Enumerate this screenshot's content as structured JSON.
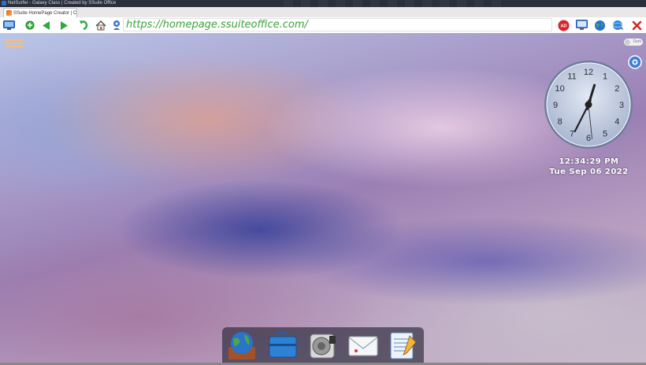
{
  "window": {
    "title": "NetSurfer - Galaxy Class | Created by SSuite Office"
  },
  "tabs": [
    {
      "label": "SSuite HomePage Creator | C"
    }
  ],
  "toolbar": {
    "buttons": [
      {
        "icon": "monitor-icon"
      },
      {
        "icon": "new-tab-icon"
      },
      {
        "icon": "back-arrow-icon"
      },
      {
        "icon": "forward-arrow-icon"
      },
      {
        "icon": "reload-icon"
      },
      {
        "icon": "home-icon"
      }
    ],
    "url": "https://homepage.ssuiteoffice.com/",
    "right_buttons": [
      {
        "icon": "ad-block-icon",
        "label": "AD"
      },
      {
        "icon": "screen-icon"
      },
      {
        "icon": "globe-icon"
      },
      {
        "icon": "globe-search-icon"
      },
      {
        "icon": "close-icon"
      }
    ]
  },
  "desktop": {
    "dark_toggle_label": "Dark",
    "clock": {
      "time": "12:34:29 PM",
      "date": "Tue Sep 06 2022",
      "hour": 12,
      "minute": 34,
      "second": 29,
      "numbers": [
        "12",
        "1",
        "2",
        "3",
        "4",
        "5",
        "6",
        "7",
        "8",
        "9",
        "10",
        "11"
      ]
    },
    "dock": [
      {
        "icon": "globe-app-icon"
      },
      {
        "icon": "briefcase-icon"
      },
      {
        "icon": "speaker-icon"
      },
      {
        "icon": "mail-icon"
      },
      {
        "icon": "notepad-icon"
      }
    ]
  },
  "colors": {
    "url_text": "#3aa13a",
    "close_red": "#d7262b",
    "back_green": "#2fa83a"
  }
}
